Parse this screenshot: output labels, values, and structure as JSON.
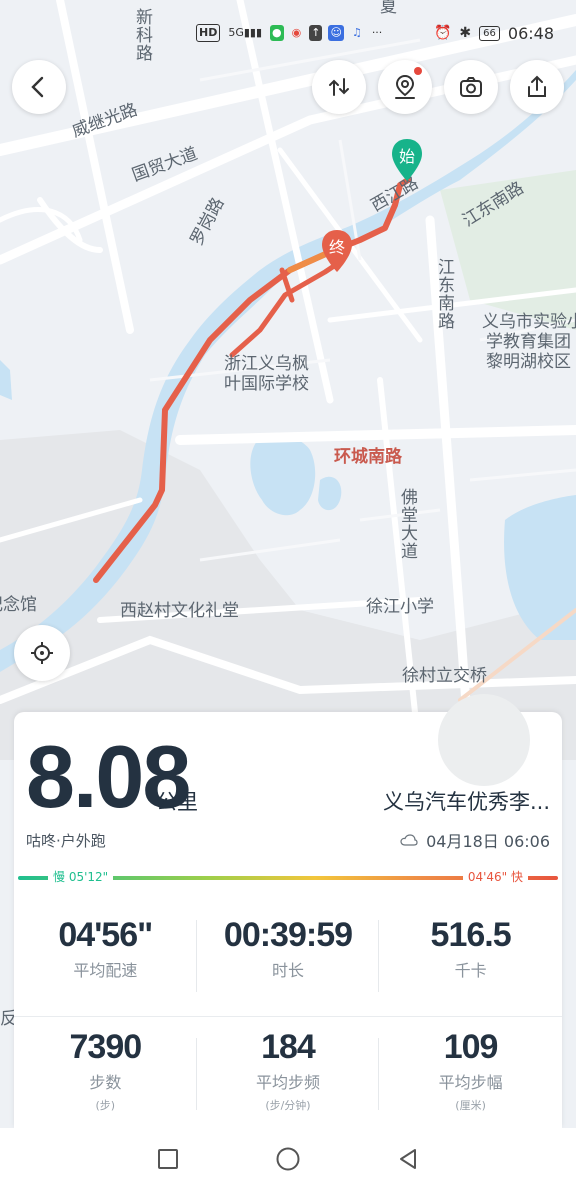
{
  "status_bar": {
    "time": "06:48",
    "battery": "66",
    "icons": [
      "hd-icon",
      "signal-5g-icon",
      "wechat-icon",
      "weibo-icon",
      "upload-icon",
      "chat-icon",
      "music-icon",
      "more-icon",
      "alarm-icon",
      "bluetooth-icon"
    ]
  },
  "map": {
    "labels": {
      "xinke_road": "新科路",
      "weiji_road": "威继光路",
      "guomao_avenue": "国贸大道",
      "luogang_road": "罗岗路",
      "xijiang_road": "西江路",
      "jiangdong_south_road_1": "江东南路",
      "jiangdong_south_road_2": "江东南路",
      "school_exp": "义乌市实验小学教育集团黎明湖校区",
      "school_exp_line1": "义乌市实验小",
      "school_exp_line2": "学教育集团",
      "school_exp_line3": "黎明湖校区",
      "maple_line1": "浙江义乌枫",
      "maple_line2": "叶国际学校",
      "ring_south_road": "环城南路",
      "fotang_avenue": "佛堂大道",
      "memorial_hall": "纪念馆",
      "xizhao_hall": "西赵村文化礼堂",
      "xujiang_school": "徐江小学",
      "xucun_interchange": "徐村立交桥",
      "xia_partial": "夏",
      "fan_partial": "反"
    },
    "markers": {
      "start": "始",
      "end": "终"
    },
    "route_color": "#e5604a",
    "river_color": "#c7e2f4"
  },
  "summary": {
    "distance": "8.08",
    "distance_unit": "公里",
    "route_name": "义乌汽车优秀李...",
    "activity_type": "咕咚·户外跑",
    "datetime": "04月18日 06:06",
    "pace_slow": "慢 05'12\"",
    "pace_fast": "04'46\" 快"
  },
  "stats": [
    {
      "value": "04'56\"",
      "label": "平均配速",
      "sub": ""
    },
    {
      "value": "00:39:59",
      "label": "时长",
      "sub": ""
    },
    {
      "value": "516.5",
      "label": "千卡",
      "sub": ""
    },
    {
      "value": "7390",
      "label": "步数",
      "sub": "(步)"
    },
    {
      "value": "184",
      "label": "平均步频",
      "sub": "(步/分钟)"
    },
    {
      "value": "109",
      "label": "平均步幅",
      "sub": "(厘米)"
    }
  ]
}
